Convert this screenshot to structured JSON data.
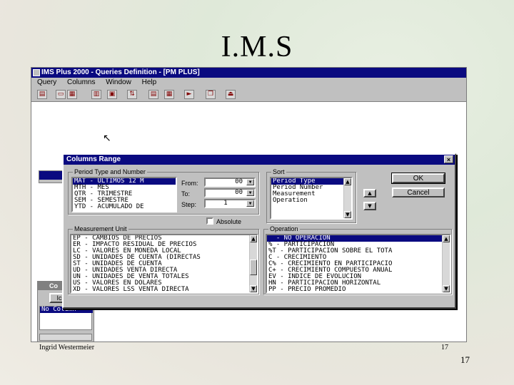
{
  "slide": {
    "title": "I.M.S",
    "author": "Ingrid Westermeier",
    "inner_page": "17",
    "page_number": "17"
  },
  "app": {
    "window_title": "IMS Plus 2000 - Queries Definition - [PM PLUS]",
    "menu": [
      "Query",
      "Columns",
      "Window",
      "Help"
    ]
  },
  "background_windows": {
    "left_title": "Co",
    "left_button": "Ic",
    "selected_item": "No Column"
  },
  "dialog": {
    "title": "Columns Range",
    "close_glyph": "×",
    "period_group": {
      "label": "Period Type and Number",
      "items": [
        "MAT - ULTIMOS 12 M",
        "MTH - MES",
        "QTR - TRIMESTRE",
        "SEM - SEMESTRE",
        "YTD - ACUMULADO DE"
      ],
      "selected_index": 0
    },
    "from_label": "From:",
    "from_value": "00",
    "to_label": "To:",
    "to_value": "00",
    "step_label": "Step:",
    "step_value": "1",
    "checkbox_label": "Absolute",
    "sort_group": {
      "label": "Sort",
      "items": [
        "Period Type",
        "Period Number",
        "Measurement",
        "Operation"
      ],
      "selected_index": 0
    },
    "ok_label": "OK",
    "cancel_label": "Cancel",
    "measurement_group": {
      "label": "Measurement Unit",
      "items": [
        "EP - CAMBIOS DE PRECIOS",
        "ER - IMPACTO RESIDUAL DE PRECIOS",
        "LC - VALORES EN MONEDA LOCAL",
        "SD - UNIDADES DE CUENTA (DIRECTAS",
        "ST - UNIDADES DE CUENTA",
        "UD - UNIDADES VENTA DIRECTA",
        "UN - UNIDADES DE VENTA TOTALES",
        "US - VALORES EN DOLARES",
        "XD - VALORES LSS VENTA DIRECTA"
      ]
    },
    "operation_group": {
      "label": "Operation",
      "items": [
        "  - NO OPERACION",
        "% - PARTICIPACION",
        "%T - PARTICIPACION SOBRE EL TOTA",
        "C - CRECIMIENTO",
        "C% - CRECIMIENTO EN PARTICIPACIO",
        "C+ - CRECIMIENTO COMPUESTO ANUAL",
        "EV - INDICE DE EVOLUCION",
        "HN - PARTICIPACION HORIZONTAL",
        "PP - PRECIO PROMEDIO"
      ],
      "selected_index": 0
    }
  },
  "icons": {
    "toolbar": [
      "open-icon",
      "folder-icon",
      "save-icon",
      "print-icon",
      "preview-icon",
      "sort-icon",
      "columns-icon",
      "grid-icon",
      "run-icon",
      "copy-icon",
      "exit-icon"
    ]
  }
}
